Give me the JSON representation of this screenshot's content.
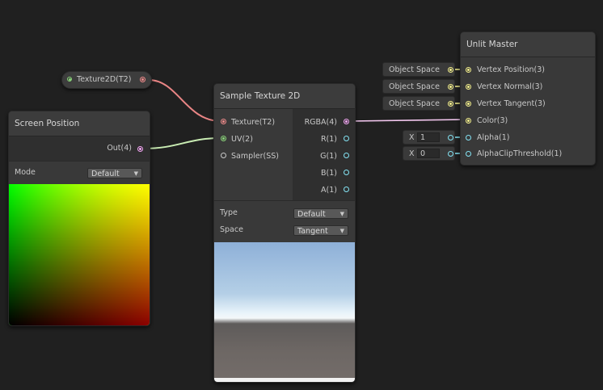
{
  "colors": {
    "background": "#202020",
    "node": "#393939",
    "texture_port": "#f08b8b",
    "uv_port": "#8bd67a",
    "vector4_port": "#f4a6f4",
    "vector3_port": "#f4f08c",
    "float_port": "#84e4f4",
    "sampler_port": "#c8c8c8"
  },
  "texture_property_node": {
    "label": "Texture2D(T2)",
    "icon": "texture-port-dot"
  },
  "screen_position": {
    "title": "Screen Position",
    "output": "Out(4)",
    "mode_label": "Mode",
    "mode_value": "Default"
  },
  "sample_texture": {
    "title": "Sample Texture 2D",
    "inputs": [
      "Texture(T2)",
      "UV(2)",
      "Sampler(SS)"
    ],
    "outputs": [
      "RGBA(4)",
      "R(1)",
      "G(1)",
      "B(1)",
      "A(1)"
    ],
    "type_label": "Type",
    "type_value": "Default",
    "space_label": "Space",
    "space_value": "Tangent"
  },
  "unlit_master": {
    "title": "Unlit Master",
    "ports": [
      "Vertex Position(3)",
      "Vertex Normal(3)",
      "Vertex Tangent(3)",
      "Color(3)",
      "Alpha(1)",
      "AlphaClipThreshold(1)"
    ],
    "space_fields": [
      "Object Space",
      "Object Space",
      "Object Space"
    ],
    "float_fields": [
      {
        "axis": "X",
        "value": "1"
      },
      {
        "axis": "X",
        "value": "0"
      }
    ]
  }
}
